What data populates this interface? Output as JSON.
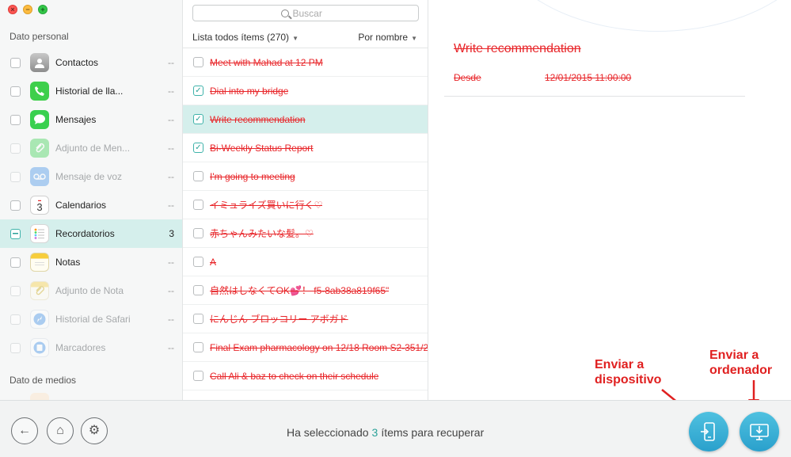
{
  "window": {
    "controls": {
      "close": "×",
      "minimize": "−",
      "maximize": "+"
    }
  },
  "sidebar": {
    "personal_header": "Dato personal",
    "media_header": "Dato de medios",
    "items": [
      {
        "label": "Contactos",
        "count": "--",
        "icon": "contacts-icon",
        "color": "#8a8a8a",
        "state": "unchecked"
      },
      {
        "label": "Historial de lla...",
        "count": "--",
        "icon": "phone-icon",
        "color": "#3ecf4b",
        "state": "unchecked"
      },
      {
        "label": "Mensajes",
        "count": "--",
        "icon": "messages-icon",
        "color": "#39d04f",
        "state": "unchecked"
      },
      {
        "label": "Adjunto de Men...",
        "count": "--",
        "icon": "message-attachment-icon",
        "color": "#39d04f",
        "state": "disabled"
      },
      {
        "label": "Mensaje de voz",
        "count": "--",
        "icon": "voicemail-icon",
        "color": "#3f8fe8",
        "state": "disabled"
      },
      {
        "label": "Calendarios",
        "count": "--",
        "icon": "calendar-icon",
        "color": "#ffffff",
        "day": "3",
        "state": "unchecked"
      },
      {
        "label": "Recordatorios",
        "count": "3",
        "icon": "reminders-icon",
        "color": "#ffffff",
        "state": "mixed"
      },
      {
        "label": "Notas",
        "count": "--",
        "icon": "notes-icon",
        "color": "#f7cd3b",
        "state": "unchecked"
      },
      {
        "label": "Adjunto de Nota",
        "count": "--",
        "icon": "note-attachment-icon",
        "color": "#f7cd3b",
        "state": "disabled"
      },
      {
        "label": "Historial de Safari",
        "count": "--",
        "icon": "safari-icon",
        "color": "#3b8de8",
        "state": "disabled"
      },
      {
        "label": "Marcadores",
        "count": "--",
        "icon": "bookmarks-icon",
        "color": "#3b8de8",
        "state": "disabled"
      }
    ]
  },
  "list": {
    "search_placeholder": "Buscar",
    "filter_label": "Lista todos ítems (270)",
    "sort_label": "Por nombre",
    "rows": [
      {
        "text": "Meet with Mahad at 12 PM",
        "checked": false,
        "selected": false
      },
      {
        "text": "Dial into my bridge",
        "checked": true,
        "selected": false
      },
      {
        "text": "Write recommendation",
        "checked": true,
        "selected": true
      },
      {
        "text": "Bi-Weekly Status Report",
        "checked": true,
        "selected": false
      },
      {
        "text": "I'm going to meeting",
        "checked": false,
        "selected": false
      },
      {
        "text": "イミュライズ買いに行く♡",
        "checked": false,
        "selected": false
      },
      {
        "text": "赤ちゃんみたいな髪。♡",
        "checked": false,
        "selected": false
      },
      {
        "text": "A",
        "checked": false,
        "selected": false
      },
      {
        "text": "自然はしなくてOK💕！ f5-8ab38a819f65\"",
        "checked": false,
        "selected": false
      },
      {
        "text": "にんじん ブロッコリー アボガド",
        "checked": false,
        "selected": false
      },
      {
        "text": "Final Exam pharmacology on 12/18 Room S2-351/2",
        "checked": false,
        "selected": false
      },
      {
        "text": "Call Ali & baz to check on their schedule",
        "checked": false,
        "selected": false
      }
    ]
  },
  "detail": {
    "title": "Write recommendation",
    "field_label": "Desde",
    "field_value": "12/01/2015 11:00:00"
  },
  "annotations": {
    "to_device_line1": "Enviar a",
    "to_device_line2": "dispositivo",
    "to_computer_line1": "Enviar a",
    "to_computer_line2": "ordenador"
  },
  "footer": {
    "status_prefix": "Ha seleccionado",
    "status_count": "3",
    "status_suffix": "ítems para recuperar",
    "back_glyph": "←",
    "home_glyph": "⌂",
    "settings_glyph": "⚙"
  },
  "colors": {
    "accent": "#2aa198",
    "deleted_text": "#e8262a",
    "selected_row": "#d5efec",
    "annotation": "#e02020",
    "action_button": "#2aa0cc"
  }
}
